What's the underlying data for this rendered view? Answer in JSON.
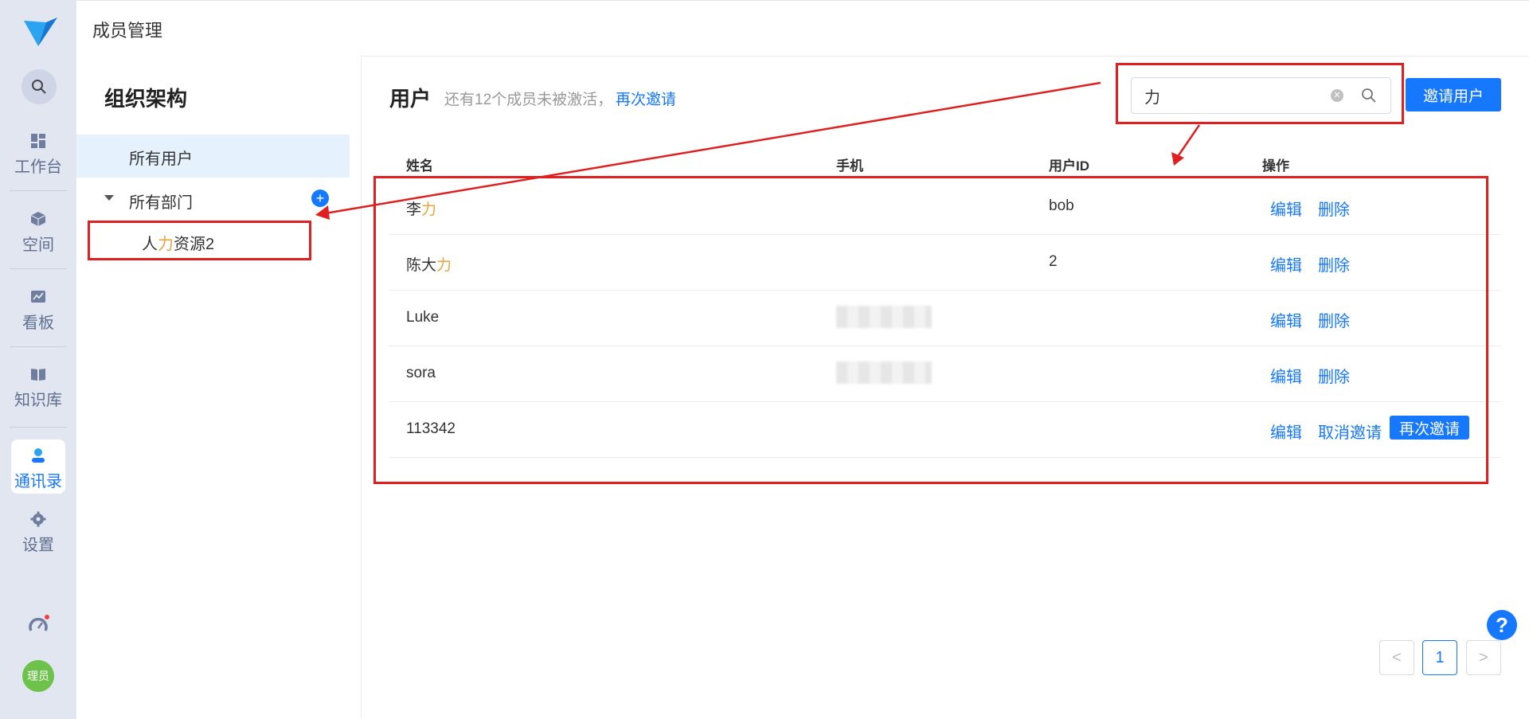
{
  "page": {
    "title": "成员管理"
  },
  "sidebar": {
    "items": [
      {
        "label": "工作台",
        "icon": "dashboard-icon"
      },
      {
        "label": "空间",
        "icon": "cube-icon"
      },
      {
        "label": "看板",
        "icon": "chart-icon"
      },
      {
        "label": "知识库",
        "icon": "book-icon"
      },
      {
        "label": "通讯录",
        "icon": "contacts-icon",
        "active": true
      },
      {
        "label": "设置",
        "icon": "gear-icon"
      }
    ],
    "avatar_text": "理员"
  },
  "org": {
    "heading": "组织架构",
    "all_users": "所有用户",
    "all_departments": "所有部门",
    "sub_department": {
      "pre": "人",
      "hl": "力",
      "post": "资源2"
    }
  },
  "users": {
    "title": "用户",
    "notice": "还有12个成员未被激活，",
    "reinvite_link": "再次邀请",
    "search_value": "力",
    "invite_button": "邀请用户",
    "columns": [
      "姓名",
      "手机",
      "用户ID",
      "操作"
    ],
    "rows": [
      {
        "name_pre": "李",
        "name_hl": "力",
        "user_id": "bob",
        "phone_masked": false
      },
      {
        "name_pre": "陈大",
        "name_hl": "力",
        "user_id": "2",
        "phone_masked": false
      },
      {
        "name_pre": "Luke",
        "name_hl": "",
        "user_id": "",
        "phone_masked": true
      },
      {
        "name_pre": "sora",
        "name_hl": "",
        "user_id": "",
        "phone_masked": true
      },
      {
        "name_pre": "113342",
        "name_hl": "",
        "user_id": "",
        "phone_masked": false
      }
    ],
    "actions": {
      "edit": "编辑",
      "delete": "删除",
      "cancel_invite": "取消邀请",
      "reinvite": "再次邀请"
    }
  },
  "pagination": {
    "prev": "<",
    "current": "1",
    "next": ">"
  },
  "help": "?",
  "colors": {
    "accent": "#1677ff",
    "highlight": "#e8a33d",
    "annotation": "#e02020",
    "sidebar_bg": "#e2e6f1"
  }
}
